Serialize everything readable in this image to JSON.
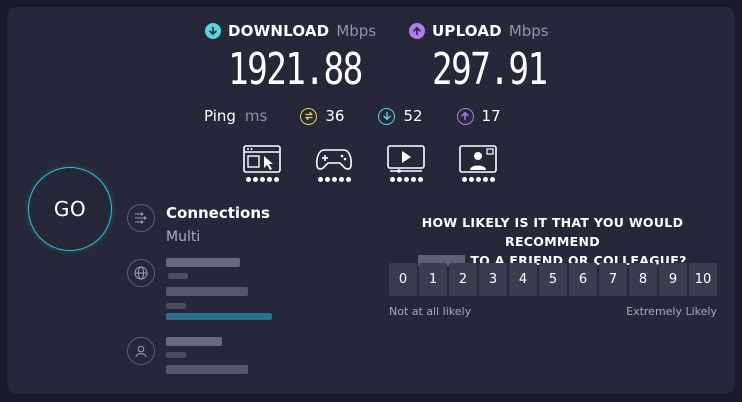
{
  "download": {
    "title": "DOWNLOAD",
    "unit": "Mbps",
    "value": "1921.88",
    "color": "#5ad5e0"
  },
  "upload": {
    "title": "UPLOAD",
    "unit": "Mbps",
    "value": "297.91",
    "color": "#b27df0"
  },
  "ping": {
    "label": "Ping",
    "unit": "ms",
    "idle": "36",
    "download": "52",
    "upload": "17",
    "idle_color": "#e8d45c"
  },
  "apps": [
    "web-browsing",
    "gaming",
    "streaming",
    "video-chat"
  ],
  "go_label": "GO",
  "connections": {
    "title": "Connections",
    "value": "Multi"
  },
  "survey": {
    "question_line1": "HOW LIKELY IS IT THAT YOU WOULD RECOMMEND",
    "question_line2": "TO A FRIEND OR COLLEAGUE?",
    "scale": [
      "0",
      "1",
      "2",
      "3",
      "4",
      "5",
      "6",
      "7",
      "8",
      "9",
      "10"
    ],
    "low_label": "Not at all likely",
    "high_label": "Extremely Likely"
  },
  "colors": {
    "accent": "#2dc3d6",
    "panel": "#262839",
    "background": "#191b29"
  }
}
